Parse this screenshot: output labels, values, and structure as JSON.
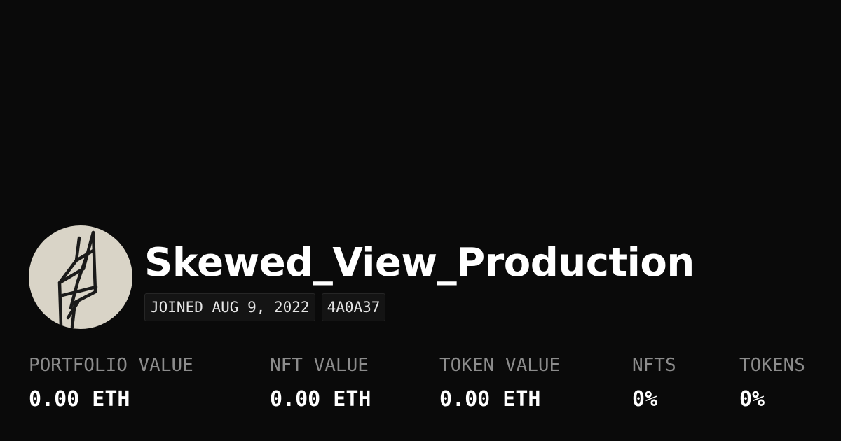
{
  "profile": {
    "name": "Skewed_View_Production",
    "joined": "JOINED AUG 9, 2022",
    "id_tag": "4A0A37",
    "avatar_icon": "sketch-grid-avatar"
  },
  "stats": [
    {
      "label": "PORTFOLIO VALUE",
      "value": "0.00 ETH"
    },
    {
      "label": "NFT VALUE",
      "value": "0.00 ETH"
    },
    {
      "label": "TOKEN VALUE",
      "value": "0.00 ETH"
    },
    {
      "label": "NFTS",
      "value": "0%"
    },
    {
      "label": "TOKENS",
      "value": "0%"
    }
  ],
  "colors": {
    "background": "#0a0a0a",
    "label": "#8c8c8c",
    "text": "#ffffff",
    "avatar_bg": "#d9d4c7"
  }
}
